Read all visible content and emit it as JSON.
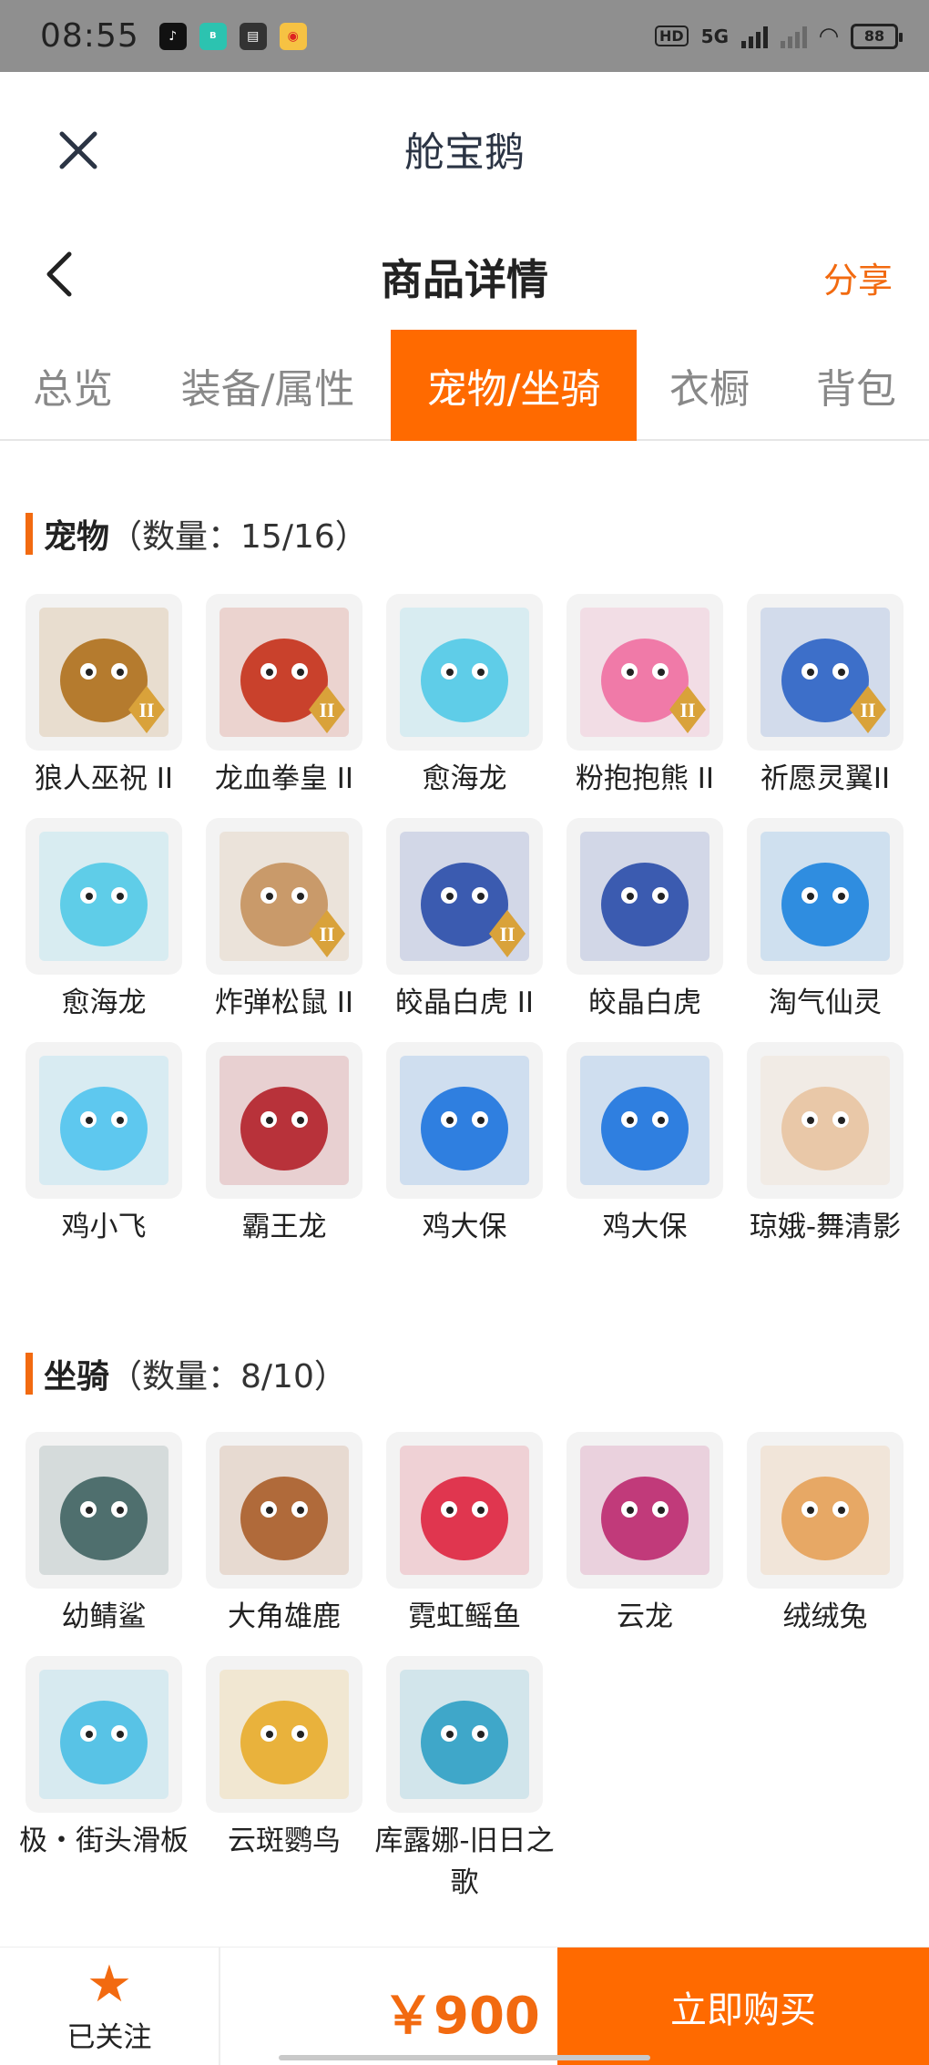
{
  "status_bar": {
    "time": "08:55",
    "hd": "HD",
    "network": "5G",
    "battery": "88"
  },
  "titlebar": {
    "title": "舱宝鹅"
  },
  "nav": {
    "title": "商品详情",
    "share": "分享"
  },
  "tabs": [
    {
      "label": "总览",
      "active": false
    },
    {
      "label": "装备/属性",
      "active": false
    },
    {
      "label": "宠物/坐骑",
      "active": true
    },
    {
      "label": "衣橱",
      "active": false
    },
    {
      "label": "背包",
      "active": false
    }
  ],
  "pets": {
    "title": "宠物",
    "count": "（数量：15/16）",
    "items": [
      {
        "name": "狼人巫祝 II",
        "icon": "werewolf-pet-icon",
        "color": "#b57b2e",
        "tier": true
      },
      {
        "name": "龙血拳皇 II",
        "icon": "dragon-boxer-pet-icon",
        "color": "#c9412c",
        "tier": true
      },
      {
        "name": "愈海龙",
        "icon": "sea-dragon-pet-icon",
        "color": "#5fcde8",
        "tier": false
      },
      {
        "name": "粉抱抱熊 II",
        "icon": "pink-bear-pet-icon",
        "color": "#f07aa8",
        "tier": true
      },
      {
        "name": "祈愿灵翼II",
        "icon": "spirit-wing-pet-icon",
        "color": "#3d6fc9",
        "tier": true
      },
      {
        "name": "愈海龙",
        "icon": "sea-dragon-pet-icon",
        "color": "#5fcde8",
        "tier": false
      },
      {
        "name": "炸弹松鼠 II",
        "icon": "squirrel-pet-icon",
        "color": "#c99a6a",
        "tier": true
      },
      {
        "name": "皎晶白虎 II",
        "icon": "white-tiger-pet-icon",
        "color": "#3b5bb0",
        "tier": true
      },
      {
        "name": "皎晶白虎",
        "icon": "white-tiger-pet-icon",
        "color": "#3b5bb0",
        "tier": false
      },
      {
        "name": "淘气仙灵",
        "icon": "fairy-pup-pet-icon",
        "color": "#2f8de0",
        "tier": false
      },
      {
        "name": "鸡小飞",
        "icon": "blue-chick-pet-icon",
        "color": "#5ec8ef",
        "tier": false
      },
      {
        "name": "霸王龙",
        "icon": "t-rex-pet-icon",
        "color": "#b8323a",
        "tier": false
      },
      {
        "name": "鸡大保",
        "icon": "cool-chick-pet-icon",
        "color": "#2f7fe0",
        "tier": false
      },
      {
        "name": "鸡大保",
        "icon": "cool-chick-pet-icon",
        "color": "#2f7fe0",
        "tier": false
      },
      {
        "name": "琼娥-舞清影",
        "icon": "dancer-pet-icon",
        "color": "#e9c8a8",
        "tier": false
      }
    ]
  },
  "mounts": {
    "title": "坐骑",
    "count": "（数量：8/10）",
    "items": [
      {
        "name": "幼鲭鲨",
        "icon": "shark-mount-icon",
        "color": "#4f6f6e"
      },
      {
        "name": "大角雄鹿",
        "icon": "stag-mount-icon",
        "color": "#b06a3a"
      },
      {
        "name": "霓虹鳐鱼",
        "icon": "neon-ray-mount-icon",
        "color": "#e0364f"
      },
      {
        "name": "云龙",
        "icon": "cloud-dragon-mount-icon",
        "color": "#c13a7a"
      },
      {
        "name": "绒绒兔",
        "icon": "fluffy-rabbit-mount-icon",
        "color": "#e7a865"
      },
      {
        "name": "极・街头滑板",
        "icon": "skateboard-mount-icon",
        "color": "#58c3e6"
      },
      {
        "name": "云斑鹦鸟",
        "icon": "parrot-mount-icon",
        "color": "#e9b23c"
      },
      {
        "name": "库露娜-旧日之歌",
        "icon": "kuluna-mount-icon",
        "color": "#3fa7c9"
      }
    ]
  },
  "bottom": {
    "follow_label": "已关注",
    "price": "￥900",
    "buy_label": "立即购买"
  },
  "colors": {
    "accent": "#ff6a00",
    "accent_text": "#f26a10"
  }
}
